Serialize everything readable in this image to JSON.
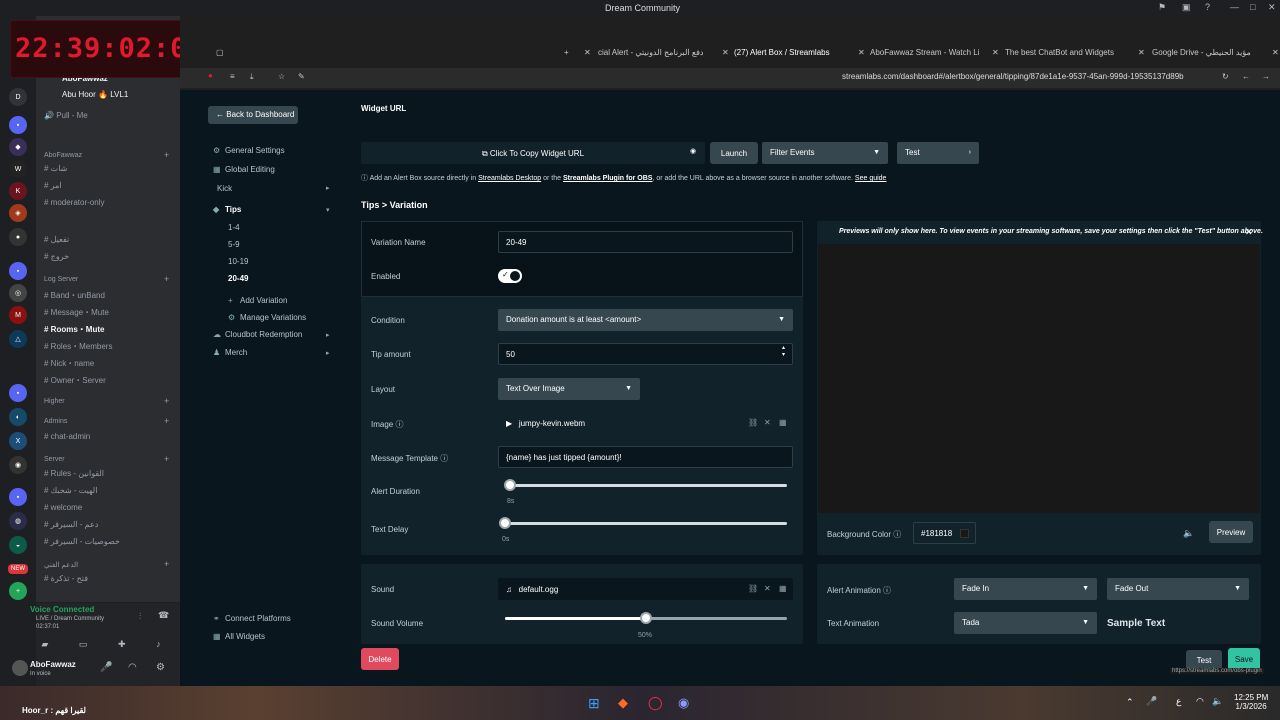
{
  "window": {
    "title": "Dream Community"
  },
  "clock": {
    "value": "22:39:02:01"
  },
  "discord": {
    "channels": [
      {
        "name": "AboFawwaz",
        "y": 0
      },
      {
        "name": "Abu Hoor 🔥 LVL1"
      },
      {
        "name": "Pull - Me"
      },
      {
        "name": "AboFawwaz"
      },
      {
        "name": "شات"
      },
      {
        "name": "امر"
      },
      {
        "name": "moderator-only"
      },
      {
        "name": "تفعيل"
      },
      {
        "name": "خروج"
      },
      {
        "name": "Log Server"
      },
      {
        "name": "Band・unBand"
      },
      {
        "name": "Message・Mute"
      },
      {
        "name": "Rooms・Mute"
      },
      {
        "name": "Roles・Members"
      },
      {
        "name": "Nick・name"
      },
      {
        "name": "Owner・Server"
      },
      {
        "name": "Higher"
      },
      {
        "name": "Admins"
      },
      {
        "name": "chat-admin"
      },
      {
        "name": "Server"
      },
      {
        "name": "Rules - القوانين"
      },
      {
        "name": "الهيت - شخبك"
      },
      {
        "name": "welcome"
      },
      {
        "name": "دعم - السيرفر"
      },
      {
        "name": "خصوصيات - السيرفر"
      },
      {
        "name": "الدعم الفني"
      },
      {
        "name": "فتح - تذكرة"
      }
    ],
    "voice": {
      "status": "Voice Connected",
      "channel": "LIVE / Dream Community",
      "time": "02:37:01"
    },
    "user": {
      "name": "AboFawwaz",
      "status": "In voice"
    }
  },
  "browser": {
    "tabs": [
      "cial Alert - دفع البرنامج الدونيتي",
      "(27) Alert Box / Streamlabs",
      "AboFawwaz Stream - Watch Li",
      "The best ChatBot and Widgets",
      "Google Drive - مؤيد الحنيطي"
    ],
    "url": "streamlabs.com/dashboard#/alertbox/general/tipping/87de1a1e-9537-45an-999d-19535137d89b"
  },
  "sidebar": {
    "back": "Back to Dashboard",
    "general_settings": "General Settings",
    "global_editing": "Global Editing",
    "kick": "Kick",
    "tips": "Tips",
    "variations": [
      "1-4",
      "5-9",
      "10-19",
      "20-49"
    ],
    "add_variation": "Add Variation",
    "manage_variations": "Manage Variations",
    "cloudbot": "Cloudbot Redemption",
    "merch": "Merch",
    "connect_platforms": "Connect Platforms",
    "all_widgets": "All Widgets"
  },
  "widget": {
    "url_label": "Widget URL",
    "copy": "Click To Copy Widget URL",
    "launch": "Launch",
    "filter": "Filter Events",
    "test": "Test",
    "info_a": "Add an Alert Box source directly in",
    "info_link1": "Streamlabs Desktop",
    "info_b": "or the",
    "info_link2": "Streamlabs Plugin for OBS",
    "info_c": ", or add the URL above as a browser source in another software.",
    "info_link3": "See guide"
  },
  "section_title": "Tips > Variation",
  "form": {
    "variation_name_label": "Variation Name",
    "variation_name": "20-49",
    "enabled_label": "Enabled",
    "condition_label": "Condition",
    "condition": "Donation amount is at least <amount>",
    "tip_amount_label": "Tip amount",
    "tip_amount": "50",
    "layout_label": "Layout",
    "layout": "Text Over Image",
    "image_label": "Image",
    "image": "jumpy-kevin.webm",
    "template_label": "Message Template",
    "template": "{name} has just tipped {amount}!",
    "duration_label": "Alert Duration",
    "duration": "8s",
    "delay_label": "Text Delay",
    "delay": "0s",
    "sound_label": "Sound",
    "sound": "default.ogg",
    "volume_label": "Sound Volume",
    "volume": "50%"
  },
  "preview": {
    "notice": "Previews will only show here. To view events in your streaming software, save your settings then click the \"Test\" button above.",
    "bg_label": "Background Color",
    "bg_value": "#181818",
    "preview_btn": "Preview",
    "alert_anim_label": "Alert Animation",
    "anim_in": "Fade In",
    "anim_out": "Fade Out",
    "text_anim_label": "Text Animation",
    "text_anim": "Tada",
    "sample": "Sample Text"
  },
  "footer": {
    "delete": "Delete",
    "test": "Test",
    "save": "Save",
    "hint": "https://streamlabs.com/obs-plugin"
  },
  "taskbar": {
    "time": "12:25 PM",
    "date": "1/3/2026",
    "left": "Hoor_r : لقيرا قهم"
  }
}
